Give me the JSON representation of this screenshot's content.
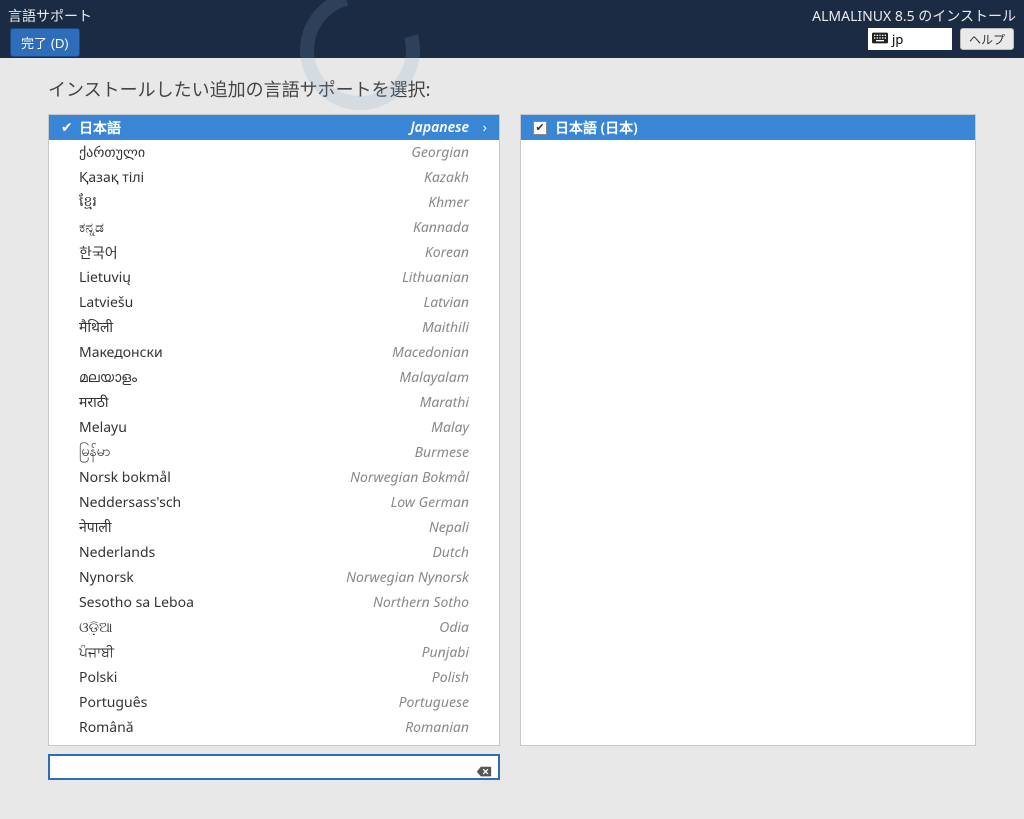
{
  "header": {
    "title": "言語サポート",
    "done_label": "完了 (D)",
    "product": "ALMALINUX 8.5 のインストール",
    "keyboard_layout": "jp",
    "help_label": "ヘルプ"
  },
  "instruction": "インストールしたい追加の言語サポートを選択:",
  "languages": [
    {
      "native": "日本語",
      "english": "Japanese",
      "selected": true,
      "checked": true
    },
    {
      "native": "ქართული",
      "english": "Georgian"
    },
    {
      "native": "Қазақ тілі",
      "english": "Kazakh"
    },
    {
      "native": "ខ្មែរ",
      "english": "Khmer"
    },
    {
      "native": "ಕನ್ನಡ",
      "english": "Kannada"
    },
    {
      "native": "한국어",
      "english": "Korean"
    },
    {
      "native": "Lietuvių",
      "english": "Lithuanian"
    },
    {
      "native": "Latviešu",
      "english": "Latvian"
    },
    {
      "native": "मैथिली",
      "english": "Maithili"
    },
    {
      "native": "Македонски",
      "english": "Macedonian"
    },
    {
      "native": "മലയാളം",
      "english": "Malayalam"
    },
    {
      "native": "मराठी",
      "english": "Marathi"
    },
    {
      "native": "Melayu",
      "english": "Malay"
    },
    {
      "native": "မြန်မာ",
      "english": "Burmese"
    },
    {
      "native": "Norsk bokmål",
      "english": "Norwegian Bokmål"
    },
    {
      "native": "Neddersass'sch",
      "english": "Low German"
    },
    {
      "native": "नेपाली",
      "english": "Nepali"
    },
    {
      "native": "Nederlands",
      "english": "Dutch"
    },
    {
      "native": "Nynorsk",
      "english": "Norwegian Nynorsk"
    },
    {
      "native": "Sesotho sa Leboa",
      "english": "Northern Sotho"
    },
    {
      "native": "ଓଡ଼ିଆ",
      "english": "Odia"
    },
    {
      "native": "ਪੰਜਾਬੀ",
      "english": "Punjabi"
    },
    {
      "native": "Polski",
      "english": "Polish"
    },
    {
      "native": "Português",
      "english": "Portuguese"
    },
    {
      "native": "Română",
      "english": "Romanian"
    }
  ],
  "locales": [
    {
      "label": "日本語 (日本)",
      "checked": true,
      "selected": true
    }
  ],
  "search": {
    "value": "",
    "placeholder": ""
  }
}
